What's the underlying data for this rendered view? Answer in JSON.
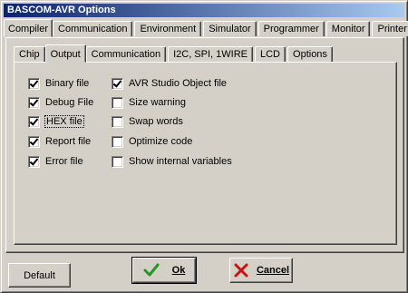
{
  "window": {
    "title": "BASCOM-AVR Options"
  },
  "tabs": [
    {
      "label": "Compiler",
      "accel": "C",
      "active": true
    },
    {
      "label": "Communication",
      "accel": "m",
      "active": false
    },
    {
      "label": "Environment",
      "accel": "E",
      "active": false
    },
    {
      "label": "Simulator",
      "accel": "S",
      "active": false
    },
    {
      "label": "Programmer",
      "accel": "P",
      "active": false
    },
    {
      "label": "Monitor",
      "accel": "o",
      "active": false
    },
    {
      "label": "Printer",
      "accel": "r",
      "active": false
    }
  ],
  "subtabs": [
    {
      "label": "Chip",
      "active": false
    },
    {
      "label": "Output",
      "active": true
    },
    {
      "label": "Communication",
      "active": false
    },
    {
      "label": "I2C, SPI, 1WIRE",
      "active": false
    },
    {
      "label": "LCD",
      "active": false
    },
    {
      "label": "Options",
      "active": false
    }
  ],
  "options_left": [
    {
      "label": "Binary file",
      "checked": true
    },
    {
      "label": "Debug File",
      "checked": true
    },
    {
      "label": "HEX file",
      "checked": true,
      "focused": true
    },
    {
      "label": "Report file",
      "checked": true
    },
    {
      "label": "Error file",
      "checked": true
    }
  ],
  "options_right": [
    {
      "label": "AVR Studio Object file",
      "checked": true
    },
    {
      "label": "Size warning",
      "checked": false
    },
    {
      "label": "Swap words",
      "checked": false
    },
    {
      "label": "Optimize code",
      "checked": false
    },
    {
      "label": "Show internal variables",
      "checked": false
    }
  ],
  "buttons": {
    "default_label": "Default",
    "ok_label": "Ok",
    "cancel_label": "Cancel"
  },
  "icons": {
    "ok": "green-checkmark-icon",
    "cancel": "red-x-icon"
  },
  "colors": {
    "title_start": "#0a246a",
    "title_end": "#a6caf0",
    "ok_icon": "#1f9a1f",
    "cancel_icon": "#cc1111"
  }
}
